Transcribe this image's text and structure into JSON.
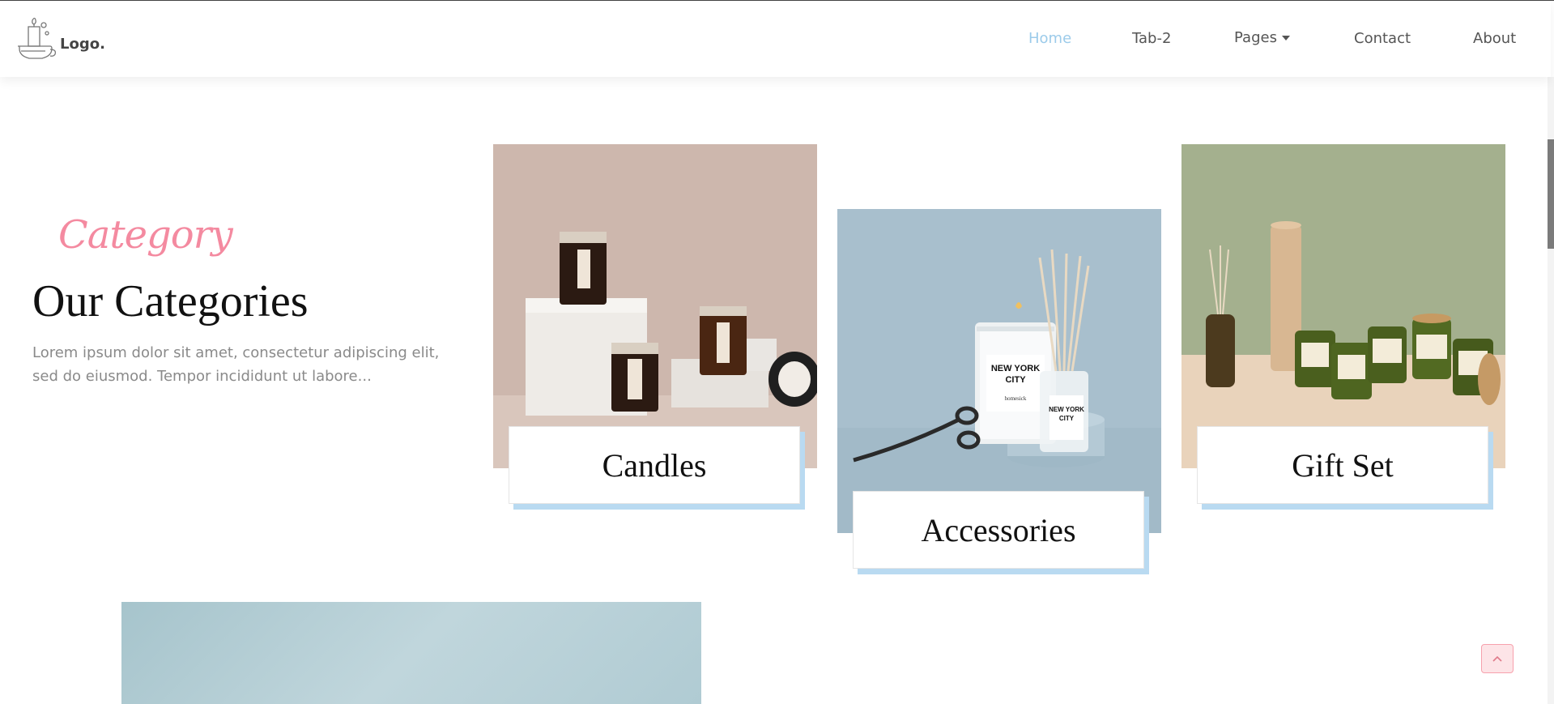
{
  "brand": {
    "logo_text": "Logo."
  },
  "nav": {
    "items": [
      {
        "label": "Home",
        "active": true
      },
      {
        "label": "Tab-2",
        "active": false
      },
      {
        "label": "Pages",
        "active": false,
        "has_dropdown": true
      },
      {
        "label": "Contact",
        "active": false
      },
      {
        "label": "About",
        "active": false
      }
    ]
  },
  "category_section": {
    "script_heading": "Category",
    "title": "Our Categories",
    "description": "Lorem ipsum dolor sit amet, consectetur adipiscing elit, sed do eiusmod. Tempor incididunt ut labore..."
  },
  "cards": [
    {
      "label": "Candles",
      "image": "candles-image"
    },
    {
      "label": "Accessories",
      "image": "accessories-image"
    },
    {
      "label": "Gift Set",
      "image": "gift-set-image"
    }
  ],
  "colors": {
    "accent_blue": "#9ccbea",
    "accent_pink": "#f48aa0",
    "card_shadow": "#b9daf1"
  },
  "icons": {
    "scroll_top": "chevron-up-icon",
    "dropdown": "caret-down-icon"
  }
}
